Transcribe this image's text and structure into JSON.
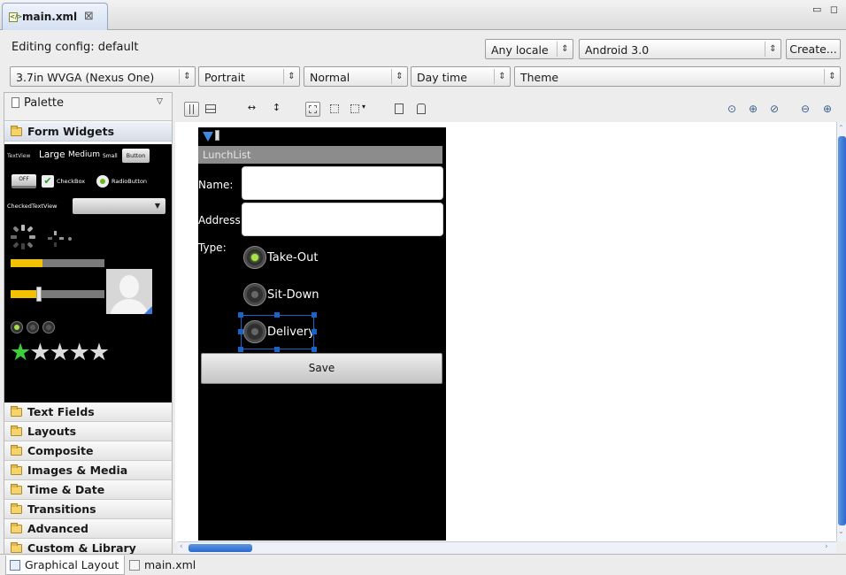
{
  "editor": {
    "tab_title": "main.xml",
    "tab_close": "⊠",
    "window_controls": "▭ ◻"
  },
  "config": {
    "editing_label": "Editing config: default",
    "locale": "Any locale",
    "api": "Android 3.0",
    "create_button": "Create...",
    "device": "3.7in WVGA (Nexus One)",
    "orientation": "Portrait",
    "dock_mode": "Normal",
    "night_mode": "Day time",
    "theme": "Theme"
  },
  "palette": {
    "title": "Palette",
    "open_category": "Form Widgets",
    "widget_samples": {
      "textview": "TextView",
      "large": "Large",
      "medium": "Medium",
      "small": "Small",
      "button": "Button",
      "toggle": "OFF",
      "checkbox": "CheckBox",
      "radiobutton": "RadioButton",
      "checkedtextview": "CheckedTextView",
      "progress_fraction": 0.34,
      "seekbar_fraction": 0.3,
      "rating_stars": 1,
      "rating_max": 5
    },
    "categories": [
      "Text Fields",
      "Layouts",
      "Composite",
      "Images & Media",
      "Time & Date",
      "Transitions",
      "Advanced",
      "Custom & Library Views"
    ]
  },
  "device_screen": {
    "app_title": "LunchList",
    "name_label": "Name:",
    "address_label": "Address:",
    "type_label": "Type:",
    "radios": [
      {
        "label": "Take-Out",
        "checked": true
      },
      {
        "label": "Sit-Down",
        "checked": false
      },
      {
        "label": "Delivery",
        "checked": false
      }
    ],
    "save_button": "Save"
  },
  "bottom_tabs": {
    "graphical": "Graphical Layout",
    "xml": "main.xml"
  },
  "colors": {
    "accent": "#1a63c7",
    "radio_on": "#a6e24a",
    "star_on": "#3ccf3c",
    "progress": "#f2c200"
  }
}
